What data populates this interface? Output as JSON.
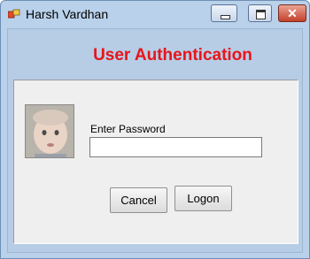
{
  "window": {
    "title": "Harsh Vardhan",
    "controls": {
      "minimize": "minimize",
      "maximize": "maximize",
      "close": "✕"
    }
  },
  "form": {
    "heading": "User Authentication",
    "password_label": "Enter Password",
    "password_value": "",
    "cancel_label": "Cancel",
    "logon_label": "Logon"
  },
  "colors": {
    "heading": "#e8141a",
    "window_background": "#b9d1ea",
    "panel_background": "#efefef",
    "close_button": "#c4402a"
  }
}
